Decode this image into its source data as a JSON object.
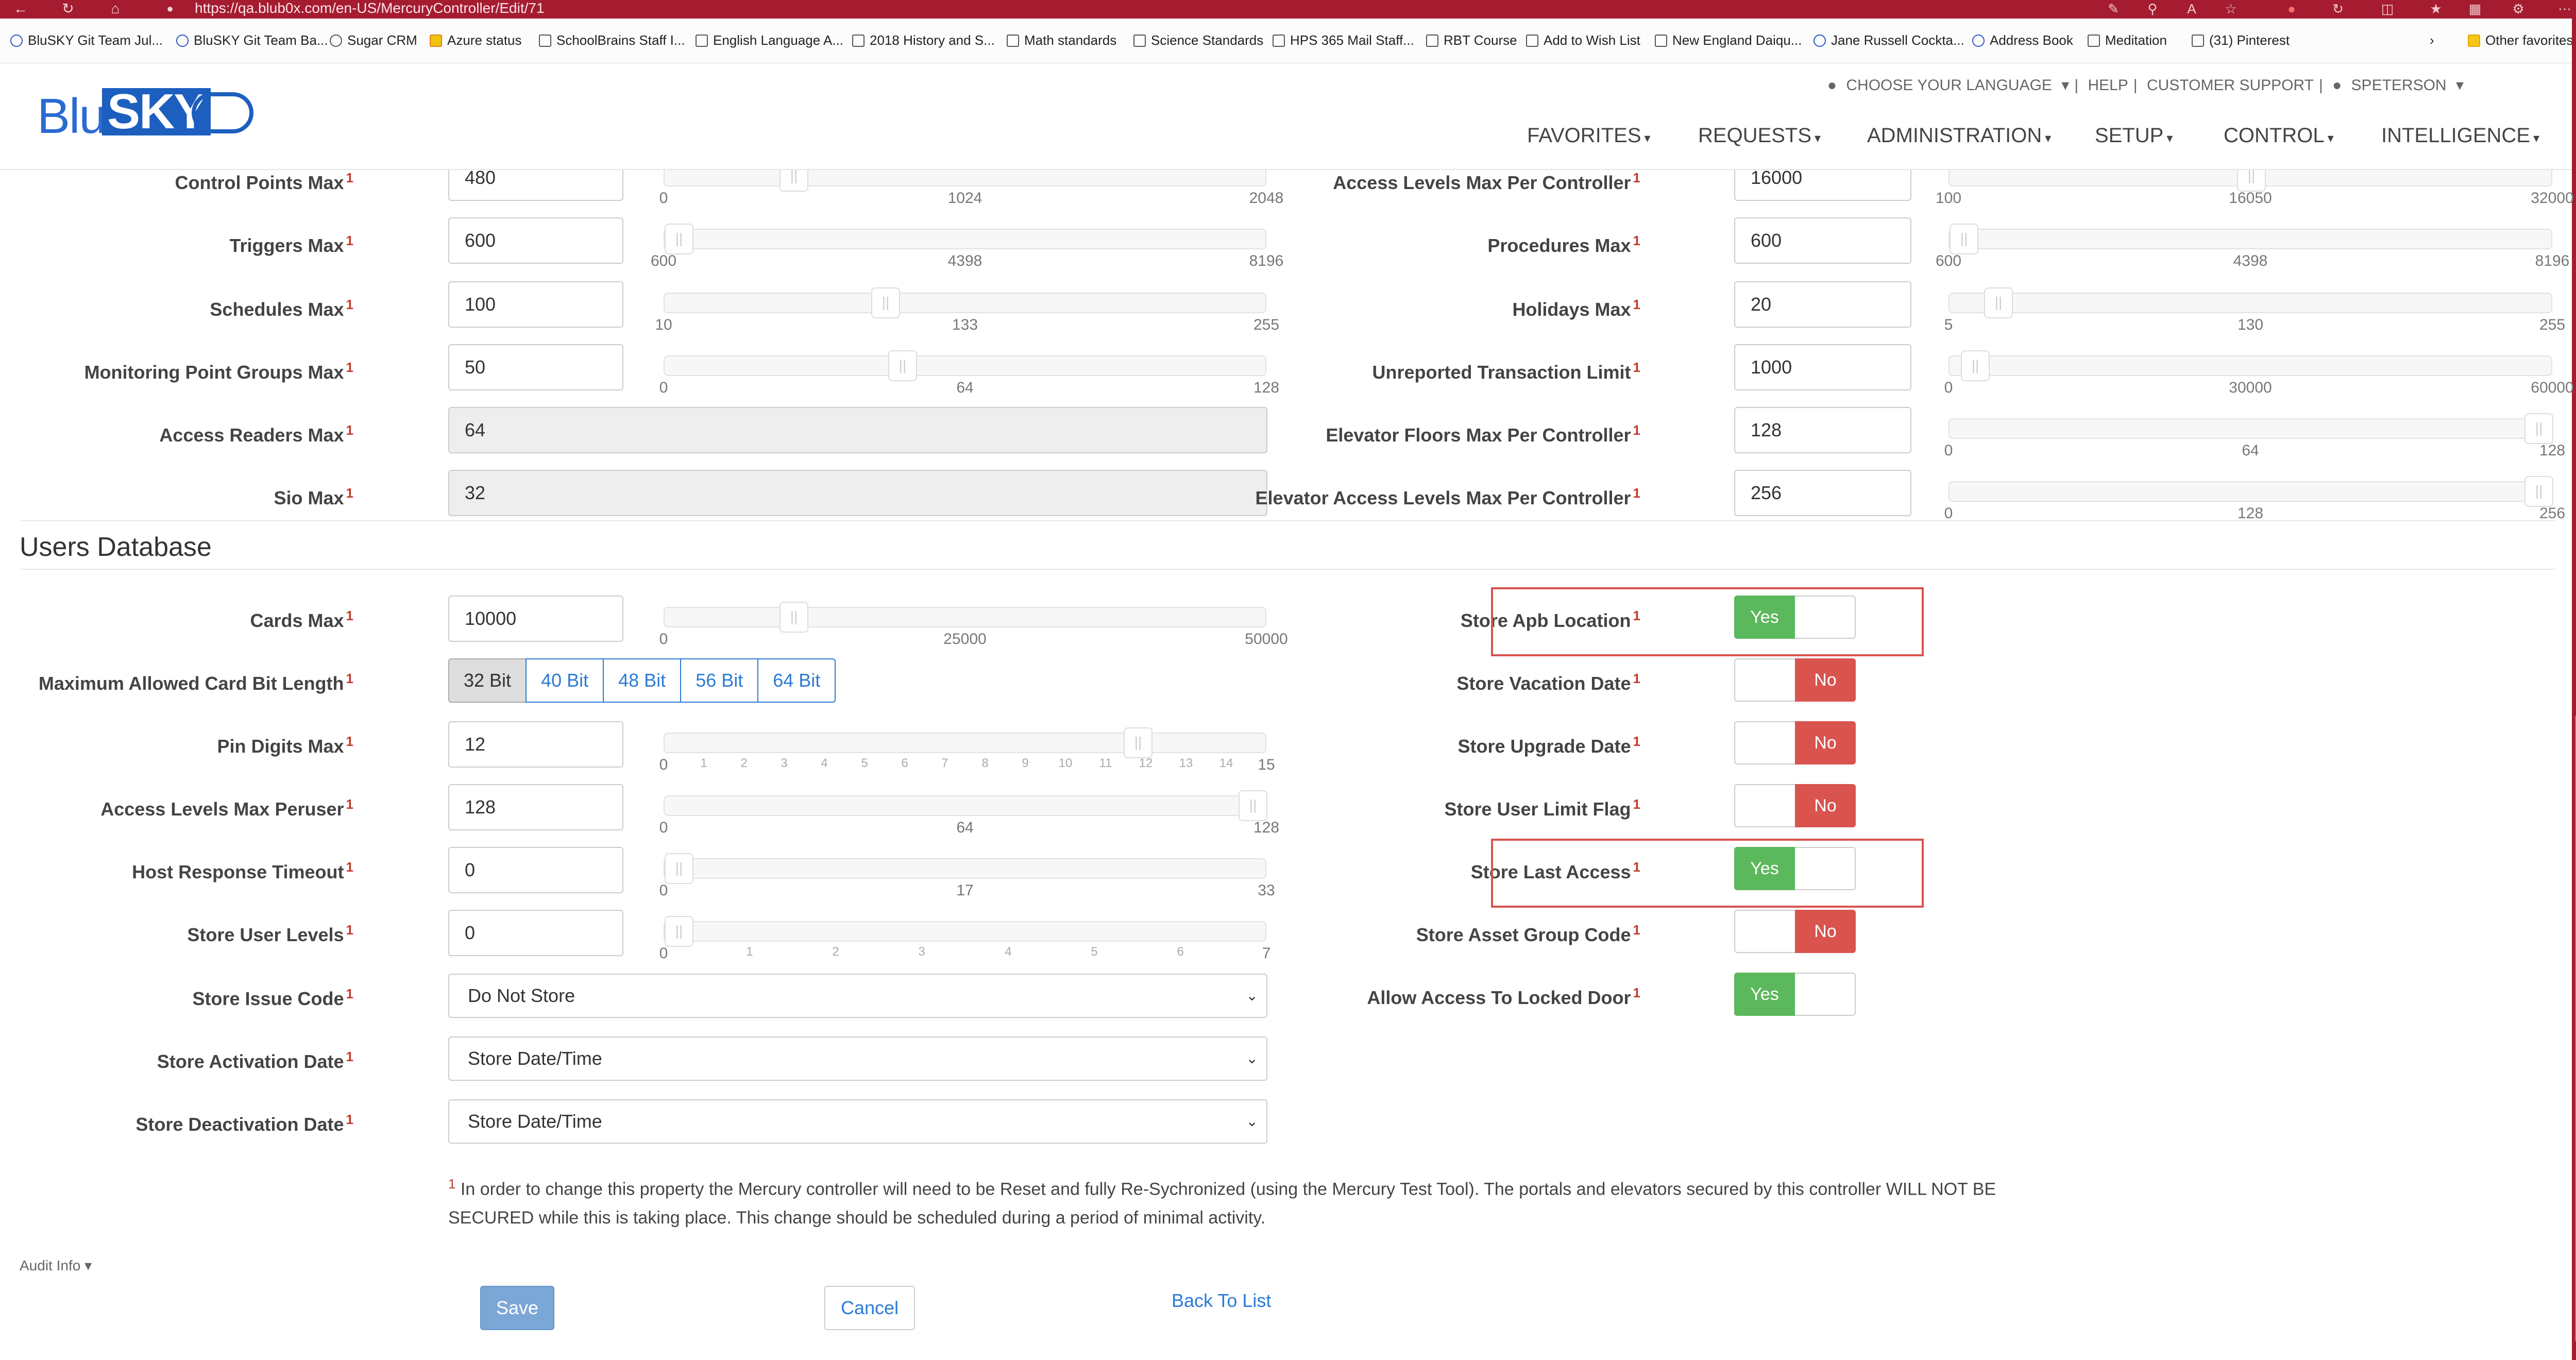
{
  "browser": {
    "url": "https://qa.blub0x.com/en-US/MercuryController/Edit/71",
    "bookmarks": [
      "BluSKY Git Team Jul...",
      "BluSKY Git Team Ba...",
      "Sugar CRM",
      "Azure status",
      "SchoolBrains Staff I...",
      "English Language A...",
      "2018 History and S...",
      "Math standards",
      "Science Standards",
      "HPS 365 Mail Staff...",
      "RBT Course",
      "Add to Wish List",
      "New England Daiqu...",
      "Jane Russell Cockta...",
      "Address Book",
      "Meditation",
      "(31) Pinterest"
    ],
    "other_favorites": "Other favorites"
  },
  "header": {
    "logo_blu": "Blu",
    "logo_sky": "SKY",
    "top_links": [
      "CHOOSE YOUR LANGUAGE",
      "HELP",
      "CUSTOMER SUPPORT",
      "SPETERSON"
    ],
    "nav": [
      "FAVORITES",
      "REQUESTS",
      "ADMINISTRATION",
      "SETUP",
      "CONTROL",
      "INTELLIGENCE"
    ]
  },
  "controller_limits": {
    "left": [
      {
        "label": "Control Points Max",
        "value": "480",
        "min": 0,
        "max": 2048,
        "mid": 1024,
        "level": 0.2
      },
      {
        "label": "Triggers Max",
        "value": "600",
        "min": 600,
        "max": 8196,
        "mid": 4398,
        "level": 0.0
      },
      {
        "label": "Schedules Max",
        "value": "100",
        "min": 10,
        "max": 255,
        "mid": 133,
        "level": 0.36
      },
      {
        "label": "Monitoring Point Groups Max",
        "value": "50",
        "min": 0,
        "max": 128,
        "mid": 64,
        "level": 0.39
      },
      {
        "label": "Access Readers Max",
        "value": "64"
      },
      {
        "label": "Sio Max",
        "value": "32"
      }
    ],
    "right": [
      {
        "label": "Access Levels Max Per Controller",
        "value": "16000",
        "min": 100,
        "max": 32000,
        "mid": 16050,
        "level": 0.5
      },
      {
        "label": "Procedures Max",
        "value": "600",
        "min": 600,
        "max": 8196,
        "mid": 4398,
        "level": 0.0
      },
      {
        "label": "Holidays Max",
        "value": "20",
        "min": 5,
        "max": 255,
        "mid": 130,
        "level": 0.06
      },
      {
        "label": "Unreported Transaction Limit",
        "value": "1000",
        "min": 0,
        "max": 60000,
        "mid": 30000,
        "level": 0.02
      },
      {
        "label": "Elevator Floors Max Per Controller",
        "value": "128",
        "min": 0,
        "max": 128,
        "mid": 64,
        "level": 1.0
      },
      {
        "label": "Elevator Access Levels Max Per Controller",
        "value": "256",
        "min": 0,
        "max": 256,
        "mid": 128,
        "level": 1.0
      }
    ]
  },
  "users_db": {
    "title": "Users Database",
    "cards_max": {
      "label": "Cards Max",
      "value": "10000",
      "min": 0,
      "max": 50000,
      "mid": 25000,
      "level": 0.2
    },
    "card_bit_length": {
      "label": "Maximum Allowed Card Bit Length",
      "options": [
        "32 Bit",
        "40 Bit",
        "48 Bit",
        "56 Bit",
        "64 Bit"
      ],
      "selected": "32 Bit"
    },
    "pin_digits_max": {
      "label": "Pin Digits Max",
      "value": "12",
      "min": 0,
      "max": 15,
      "level": 0.8,
      "ticks": [
        "0",
        "1",
        "2",
        "3",
        "4",
        "5",
        "6",
        "7",
        "8",
        "9",
        "10",
        "11",
        "12",
        "13",
        "14",
        "15"
      ]
    },
    "access_levels_max_peruser": {
      "label": "Access Levels Max Peruser",
      "value": "128",
      "min": 0,
      "max": 128,
      "mid": 64,
      "level": 1.0
    },
    "host_response_timeout": {
      "label": "Host Response Timeout",
      "value": "0",
      "min": 0,
      "max": 33,
      "mid": 17,
      "level": 0.0
    },
    "store_user_levels": {
      "label": "Store User Levels",
      "value": "0",
      "min": 0,
      "max": 7,
      "level": 0.0,
      "ticks": [
        "0",
        "1",
        "2",
        "3",
        "4",
        "5",
        "6",
        "7"
      ]
    },
    "store_issue_code": {
      "label": "Store Issue Code",
      "value": "Do Not Store"
    },
    "store_activation_date": {
      "label": "Store Activation Date",
      "value": "Store Date/Time"
    },
    "store_deactivation_date": {
      "label": "Store Deactivation Date",
      "value": "Store Date/Time"
    },
    "toggles": [
      {
        "label": "Store Apb Location",
        "value": "Yes",
        "highlighted": true
      },
      {
        "label": "Store Vacation Date",
        "value": "No",
        "highlighted": false
      },
      {
        "label": "Store Upgrade Date",
        "value": "No",
        "highlighted": false
      },
      {
        "label": "Store User Limit Flag",
        "value": "No",
        "highlighted": false
      },
      {
        "label": "Store Last Access",
        "value": "Yes",
        "highlighted": true
      },
      {
        "label": "Store Asset Group Code",
        "value": "No",
        "highlighted": false
      },
      {
        "label": "Allow Access To Locked Door",
        "value": "Yes",
        "highlighted": false
      }
    ],
    "footnote_marker": "1"
  },
  "footnote": {
    "line1": "In order to change this property the Mercury controller will need to be Reset and fully Re-Sychronized (using the Mercury Test Tool). The portals and elevators secured by this controller WILL NOT BE",
    "line2": "SECURED while this is taking place. This change should be scheduled during a period of minimal activity."
  },
  "footer": {
    "audit_info": "Audit Info",
    "save": "Save",
    "cancel": "Cancel",
    "back": "Back To List"
  },
  "colors": {
    "browser_red": "#a51c30",
    "yes_green": "#5cb85c",
    "no_red": "#d9534f",
    "link_blue": "#2b7bd4",
    "save_blue": "#7ba7d7"
  }
}
